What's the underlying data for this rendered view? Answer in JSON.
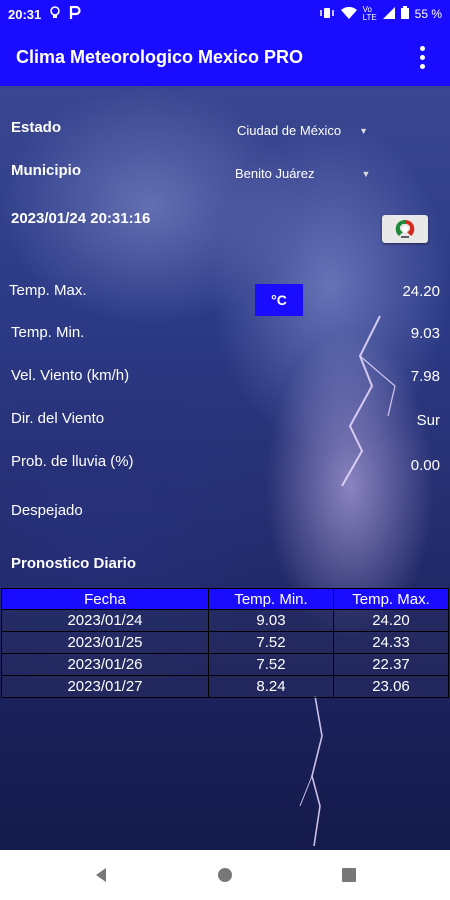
{
  "status_bar": {
    "time": "20:31",
    "battery": "55 %",
    "network": "Vo LTE"
  },
  "app_bar": {
    "title": "Clima Meteorologico Mexico PRO"
  },
  "form": {
    "estado_label": "Estado",
    "estado_value": "Ciudad de México",
    "municipio_label": "Municipio",
    "municipio_value": "Benito Juárez",
    "datetime": "2023/01/24 20:31:16"
  },
  "unit_button": "°C",
  "current": {
    "temp_max_label": "Temp. Max.",
    "temp_max_value": "24.20",
    "temp_min_label": "Temp. Min.",
    "temp_min_value": "9.03",
    "wind_speed_label": "Vel. Viento (km/h)",
    "wind_speed_value": "7.98",
    "wind_dir_label": "Dir. del Viento",
    "wind_dir_value": "Sur",
    "rain_prob_label": "Prob. de lluvia (%)",
    "rain_prob_value": "0.00",
    "condition": "Despejado"
  },
  "forecast": {
    "title": "Pronostico Diario",
    "headers": [
      "Fecha",
      "Temp. Min.",
      "Temp. Max."
    ],
    "rows": [
      [
        "2023/01/24",
        "9.03",
        "24.20"
      ],
      [
        "2023/01/25",
        "7.52",
        "24.33"
      ],
      [
        "2023/01/26",
        "7.52",
        "22.37"
      ],
      [
        "2023/01/27",
        "8.24",
        "23.06"
      ]
    ]
  },
  "colors": {
    "accent": "#1a0dff",
    "flag_green": "#1f8a3a",
    "flag_red": "#d52b1e"
  },
  "icons": {
    "status_left": [
      "lightbulb-icon",
      "parking-icon"
    ],
    "status_right": [
      "vibrate-icon",
      "wifi-icon",
      "signal-icon",
      "battery-icon"
    ],
    "nav": [
      "back-icon",
      "home-icon",
      "recents-icon"
    ],
    "flag": "mexico-flag-icon",
    "overflow": "more-vert-icon"
  }
}
